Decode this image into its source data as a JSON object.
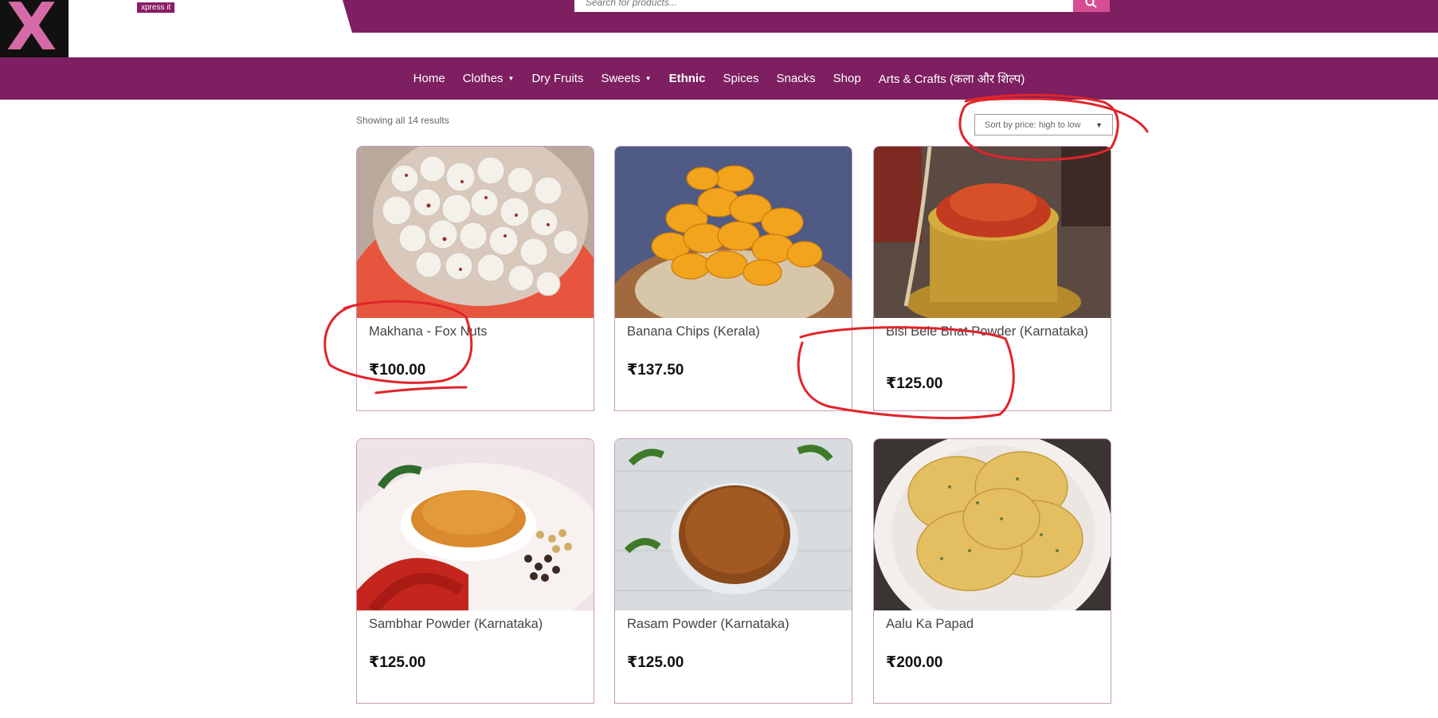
{
  "brand": {
    "tagline": "xpress it"
  },
  "search": {
    "placeholder": "Search for products..."
  },
  "nav": {
    "items": [
      {
        "label": "Home"
      },
      {
        "label": "Clothes",
        "has_dropdown": true
      },
      {
        "label": "Dry Fruits"
      },
      {
        "label": "Sweets",
        "has_dropdown": true
      },
      {
        "label": "Ethnic",
        "active": true
      },
      {
        "label": "Spices"
      },
      {
        "label": "Snacks"
      },
      {
        "label": "Shop"
      },
      {
        "label": "Arts & Crafts (कला और शिल्प)"
      }
    ]
  },
  "shop": {
    "result_count": "Showing all 14 results",
    "sort_selected": "Sort by price: high to low"
  },
  "products": [
    {
      "title": "Makhana - Fox Nuts",
      "price": "₹100.00"
    },
    {
      "title": "Banana Chips (Kerala)",
      "price": "₹137.50"
    },
    {
      "title": "Bisi Bele Bhat Powder (Karnataka)",
      "price": "₹125.00"
    },
    {
      "title": "Sambhar Powder (Karnataka)",
      "price": "₹125.00"
    },
    {
      "title": "Rasam Powder (Karnataka)",
      "price": "₹125.00"
    },
    {
      "title": "Aalu Ka Papad",
      "price": "₹200.00"
    }
  ],
  "colors": {
    "brand": "#7d1f60",
    "accent": "#d64e92",
    "annotation": "#e0242b"
  }
}
